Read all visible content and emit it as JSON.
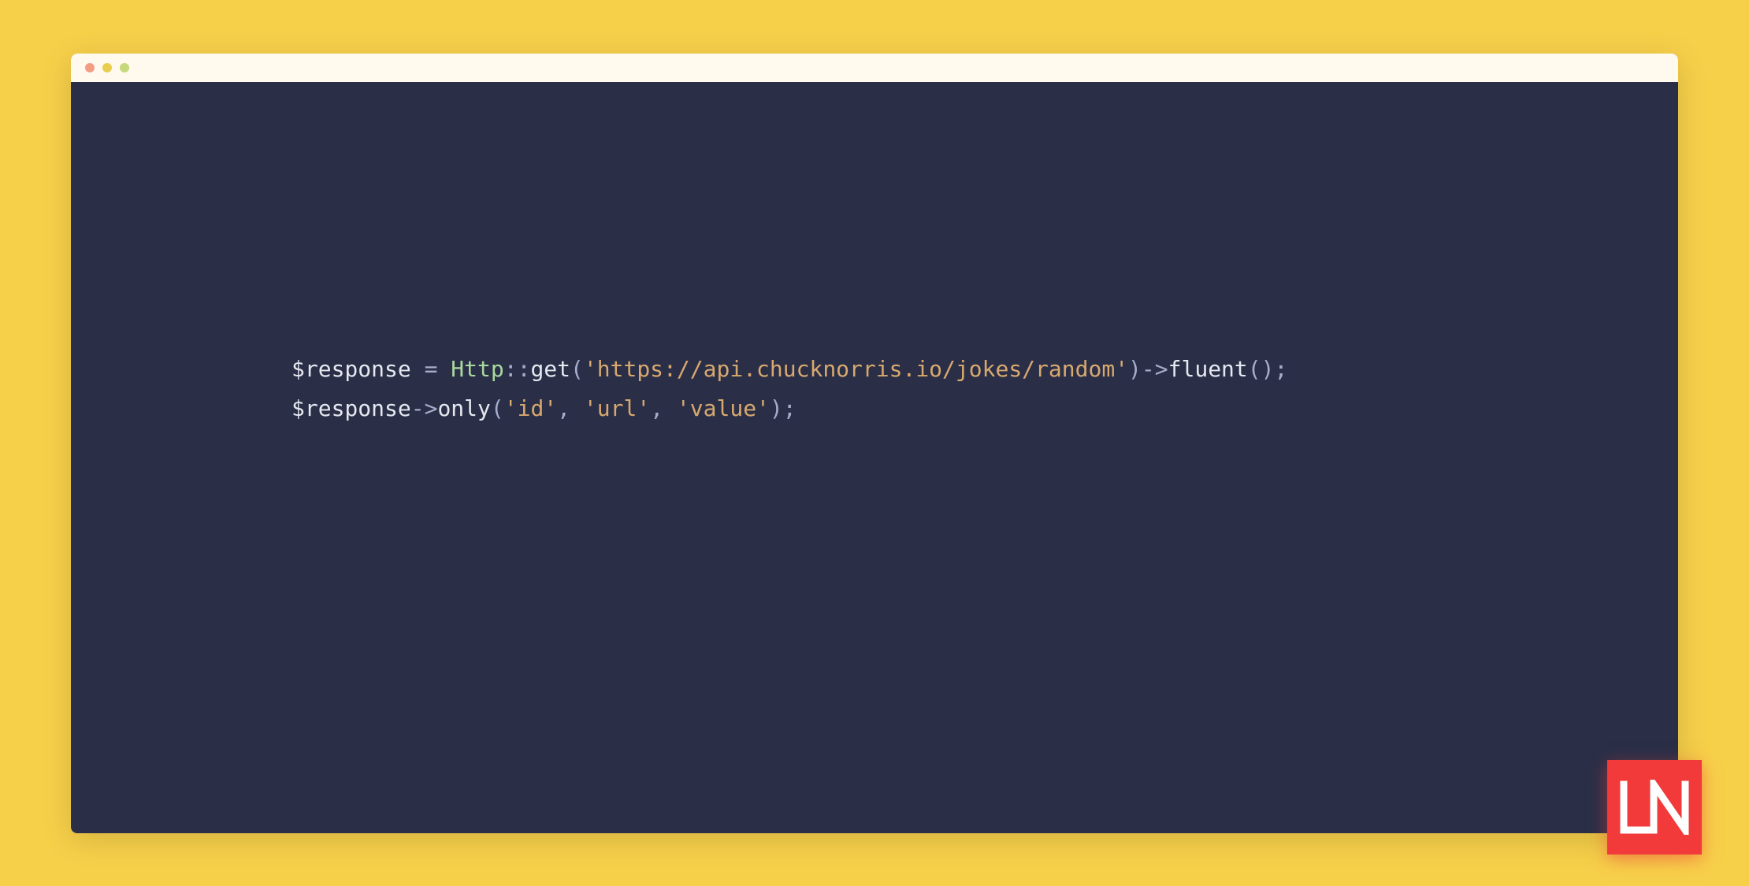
{
  "colors": {
    "background": "#f7d04a",
    "editor_bg": "#2a2f47",
    "titlebar_bg": "#fffaed",
    "dot_red": "#f49d85",
    "dot_yellow": "#e8cd4e",
    "dot_green": "#c5d87a",
    "logo_bg": "#f23a3a"
  },
  "code": {
    "line1": {
      "var": "$response",
      "eq": " = ",
      "class": "Http",
      "scope": "::",
      "fn1": "get",
      "paren_open1": "(",
      "str1": "'https://api.chucknorris.io/jokes/random'",
      "paren_close1": ")",
      "arrow": "->",
      "fn2": "fluent",
      "paren_open2": "(",
      "paren_close2": ")",
      "semi": ";"
    },
    "line2": {
      "var": "$response",
      "arrow": "->",
      "fn": "only",
      "paren_open": "(",
      "str1": "'id'",
      "comma1": ", ",
      "str2": "'url'",
      "comma2": ", ",
      "str3": "'value'",
      "paren_close": ")",
      "semi": ";"
    }
  },
  "logo_text": "LN"
}
